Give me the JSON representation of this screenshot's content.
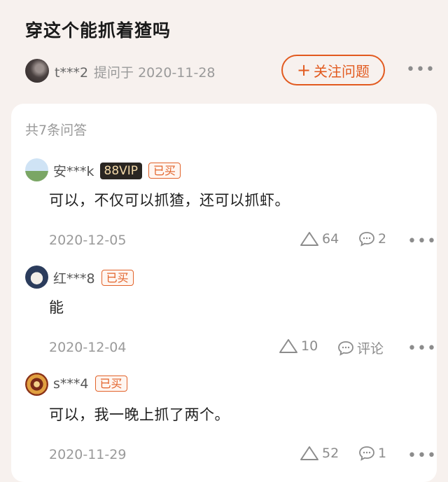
{
  "question": {
    "title": "穿这个能抓着猹吗",
    "asker": "t***2",
    "asked_at": "提问于 2020-11-28",
    "follow_label": "关注问题",
    "follow_icon": "plus-icon"
  },
  "answers_count": "共7条问答",
  "answers": [
    {
      "user": "安***k",
      "vip": "88VIP",
      "badge": "已买",
      "text": "可以，不仅可以抓猹，还可以抓虾。",
      "date": "2020-12-05",
      "likes": "64",
      "comments": "2"
    },
    {
      "user": "红***8",
      "badge": "已买",
      "text": "能",
      "date": "2020-12-04",
      "likes": "10",
      "comments": "评论"
    },
    {
      "user": "s***4",
      "badge": "已买",
      "text": "可以，我一晚上抓了两个。",
      "date": "2020-11-29",
      "likes": "52",
      "comments": "1"
    }
  ],
  "colors": {
    "accent": "#e25a1f",
    "background": "#f7f1ee",
    "card": "#ffffff"
  }
}
